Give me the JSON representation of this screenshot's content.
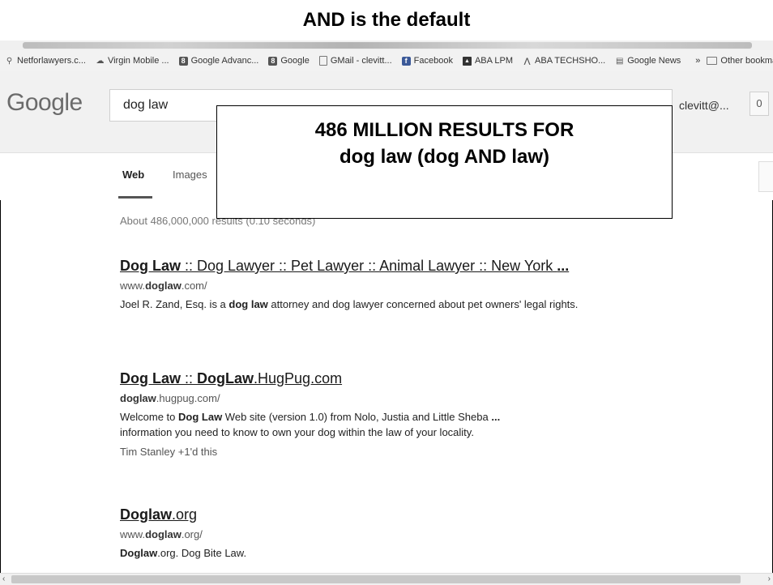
{
  "slide": {
    "title": "AND is the default"
  },
  "bookmarks": {
    "items": [
      {
        "label": "Netforlawyers.c...",
        "icon": "pin-icon"
      },
      {
        "label": "Virgin Mobile ...",
        "icon": "cloud-icon"
      },
      {
        "label": "Google Advanc...",
        "icon": "google-icon"
      },
      {
        "label": "Google",
        "icon": "google-icon"
      },
      {
        "label": "GMail - clevitt...",
        "icon": "doc-icon"
      },
      {
        "label": "Facebook",
        "icon": "facebook-icon"
      },
      {
        "label": "ABA LPM",
        "icon": "aba-icon"
      },
      {
        "label": "ABA TECHSHO...",
        "icon": "mountain-icon"
      },
      {
        "label": "Google News",
        "icon": "news-icon"
      }
    ],
    "more": "»",
    "other": "Other bookmar"
  },
  "header": {
    "logo": "Google",
    "search_value": "dog law",
    "account": "clevitt@...",
    "notifications": "0"
  },
  "tabs": {
    "web": "Web",
    "images": "Images"
  },
  "callout": {
    "line1": "486 MILLION RESULTS FOR",
    "line2": "dog law (dog AND law)"
  },
  "results": {
    "stats": "About 486,000,000 results (0.10 seconds)",
    "items": [
      {
        "title_bold": "Dog Law",
        "title_rest": " :: Dog Lawyer :: Pet Lawyer :: Animal Lawyer :: New York ",
        "title_ellipsis": "...",
        "url_pre": "www.",
        "url_bold": "doglaw",
        "url_post": ".com/",
        "snippet_pre": "Joel R. Zand, Esq. is a ",
        "snippet_bold": "dog law",
        "snippet_post": " attorney and dog lawyer concerned about pet owners' legal rights."
      },
      {
        "title_bold": "Dog Law",
        "title_mid": " :: ",
        "title_bold2": "DogLaw",
        "title_rest": ".HugPug.com",
        "url_bold": "doglaw",
        "url_post": ".hugpug.com/",
        "snippet_pre": "Welcome to ",
        "snippet_bold": "Dog Law",
        "snippet_mid": " Web site (version 1.0) from Nolo, Justia and Little Sheba ",
        "snippet_ellipsis": "...",
        "snippet_line2": "information you need to know to own your dog within the law of your locality.",
        "extra": "Tim Stanley +1'd this"
      },
      {
        "title_bold": "Doglaw",
        "title_rest": ".org",
        "url_pre": "www.",
        "url_bold": "doglaw",
        "url_post": ".org/",
        "snippet_bold": "Doglaw",
        "snippet_post": ".org. Dog Bite Law."
      }
    ]
  },
  "scrollbar": {
    "left": "‹",
    "right": "›"
  }
}
